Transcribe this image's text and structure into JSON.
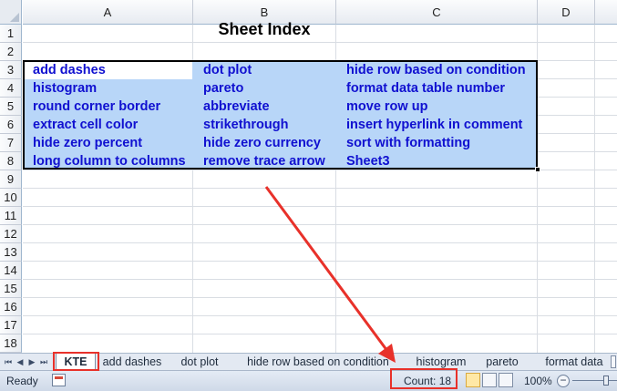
{
  "columns": [
    "A",
    "B",
    "C",
    "D"
  ],
  "rows": [
    "1",
    "2",
    "3",
    "4",
    "5",
    "6",
    "7",
    "8",
    "9",
    "10",
    "11",
    "12",
    "13",
    "14",
    "15",
    "16",
    "17",
    "18"
  ],
  "sheet_title": "Sheet Index",
  "cells": {
    "A": [
      "add dashes",
      "histogram",
      "round corner border",
      "extract cell color",
      "hide zero percent",
      "long column to columns"
    ],
    "B": [
      "dot plot",
      "pareto",
      "abbreviate",
      "strikethrough",
      "hide zero currency",
      "remove trace arrow"
    ],
    "C": [
      "hide row based on condition",
      "format data table number",
      "move row up",
      "insert hyperlink in comment",
      "sort with formatting",
      "Sheet3"
    ]
  },
  "tabs": [
    "KTE",
    "add dashes",
    "dot plot",
    "hide row based on condition",
    "histogram",
    "pareto",
    "format data"
  ],
  "active_tab": "KTE",
  "nav_buttons": [
    "⏮",
    "◀",
    "▶",
    "⏭"
  ],
  "status": {
    "ready": "Ready",
    "count": "Count: 18",
    "zoom": "100%",
    "zoom_minus": "−"
  },
  "colors": {
    "highlight": "#e8312a",
    "selection": "#b8d6f8",
    "link_text": "#1010d0"
  },
  "icons": [
    "macro-record-icon",
    "normal-view-icon",
    "page-layout-icon",
    "page-break-icon"
  ]
}
